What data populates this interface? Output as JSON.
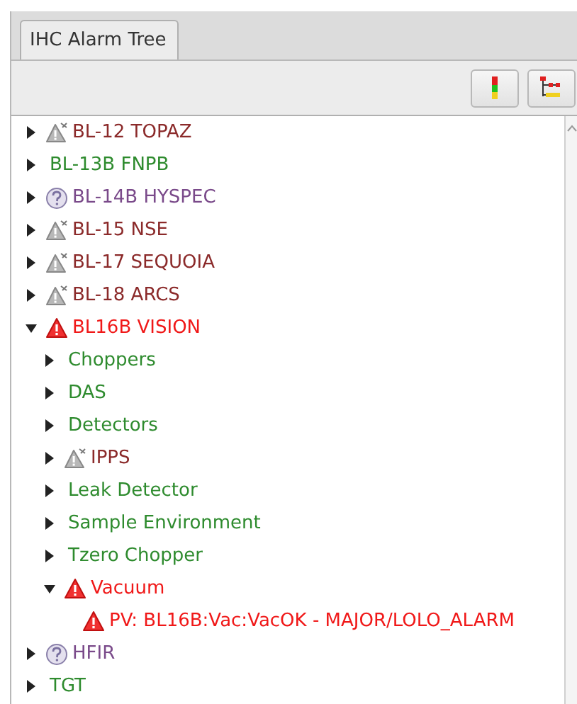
{
  "tab": {
    "label": "IHC Alarm Tree",
    "selected": true
  },
  "toolbar": [
    {
      "kind": "alarm-level"
    },
    {
      "kind": "tree-expand"
    }
  ],
  "tree": [
    {
      "label": "BL-12 TOPAZ",
      "kind": "disconnected",
      "color": "#8b2a2a",
      "expanded": false
    },
    {
      "label": "BL-13B FNPB",
      "kind": "ok",
      "color": "#2e8b2e",
      "expanded": false
    },
    {
      "label": "BL-14B HYSPEC",
      "kind": "undefined",
      "color": "#7a4a8a",
      "expanded": false
    },
    {
      "label": "BL-15 NSE",
      "kind": "disconnected",
      "color": "#8b2a2a",
      "expanded": false
    },
    {
      "label": "BL-17 SEQUOIA",
      "kind": "disconnected",
      "color": "#8b2a2a",
      "expanded": false
    },
    {
      "label": "BL-18 ARCS",
      "kind": "disconnected",
      "color": "#8b2a2a",
      "expanded": false
    },
    {
      "label": "BL16B VISION",
      "kind": "major",
      "color": "#f01818",
      "expanded": true,
      "children": [
        {
          "label": "Choppers",
          "kind": "ok",
          "color": "#2e8b2e",
          "expanded": false
        },
        {
          "label": "DAS",
          "kind": "ok",
          "color": "#2e8b2e",
          "expanded": false
        },
        {
          "label": "Detectors",
          "kind": "ok",
          "color": "#2e8b2e",
          "expanded": false
        },
        {
          "label": "IPPS",
          "kind": "disconnected",
          "color": "#8b2a2a",
          "expanded": false
        },
        {
          "label": "Leak Detector",
          "kind": "ok",
          "color": "#2e8b2e",
          "expanded": false
        },
        {
          "label": "Sample Environment",
          "kind": "ok",
          "color": "#2e8b2e",
          "expanded": false
        },
        {
          "label": "Tzero Chopper",
          "kind": "ok",
          "color": "#2e8b2e",
          "expanded": false
        },
        {
          "label": "Vacuum",
          "kind": "major",
          "color": "#f01818",
          "expanded": true,
          "children": [
            {
              "label": "PV: BL16B:Vac:VacOK - MAJOR/LOLO_ALARM",
              "kind": "major",
              "color": "#f01818"
            }
          ]
        }
      ]
    },
    {
      "label": "HFIR",
      "kind": "undefined",
      "color": "#7a4a8a",
      "expanded": false
    },
    {
      "label": "TGT",
      "kind": "ok",
      "color": "#2e8b2e",
      "expanded": false
    }
  ]
}
